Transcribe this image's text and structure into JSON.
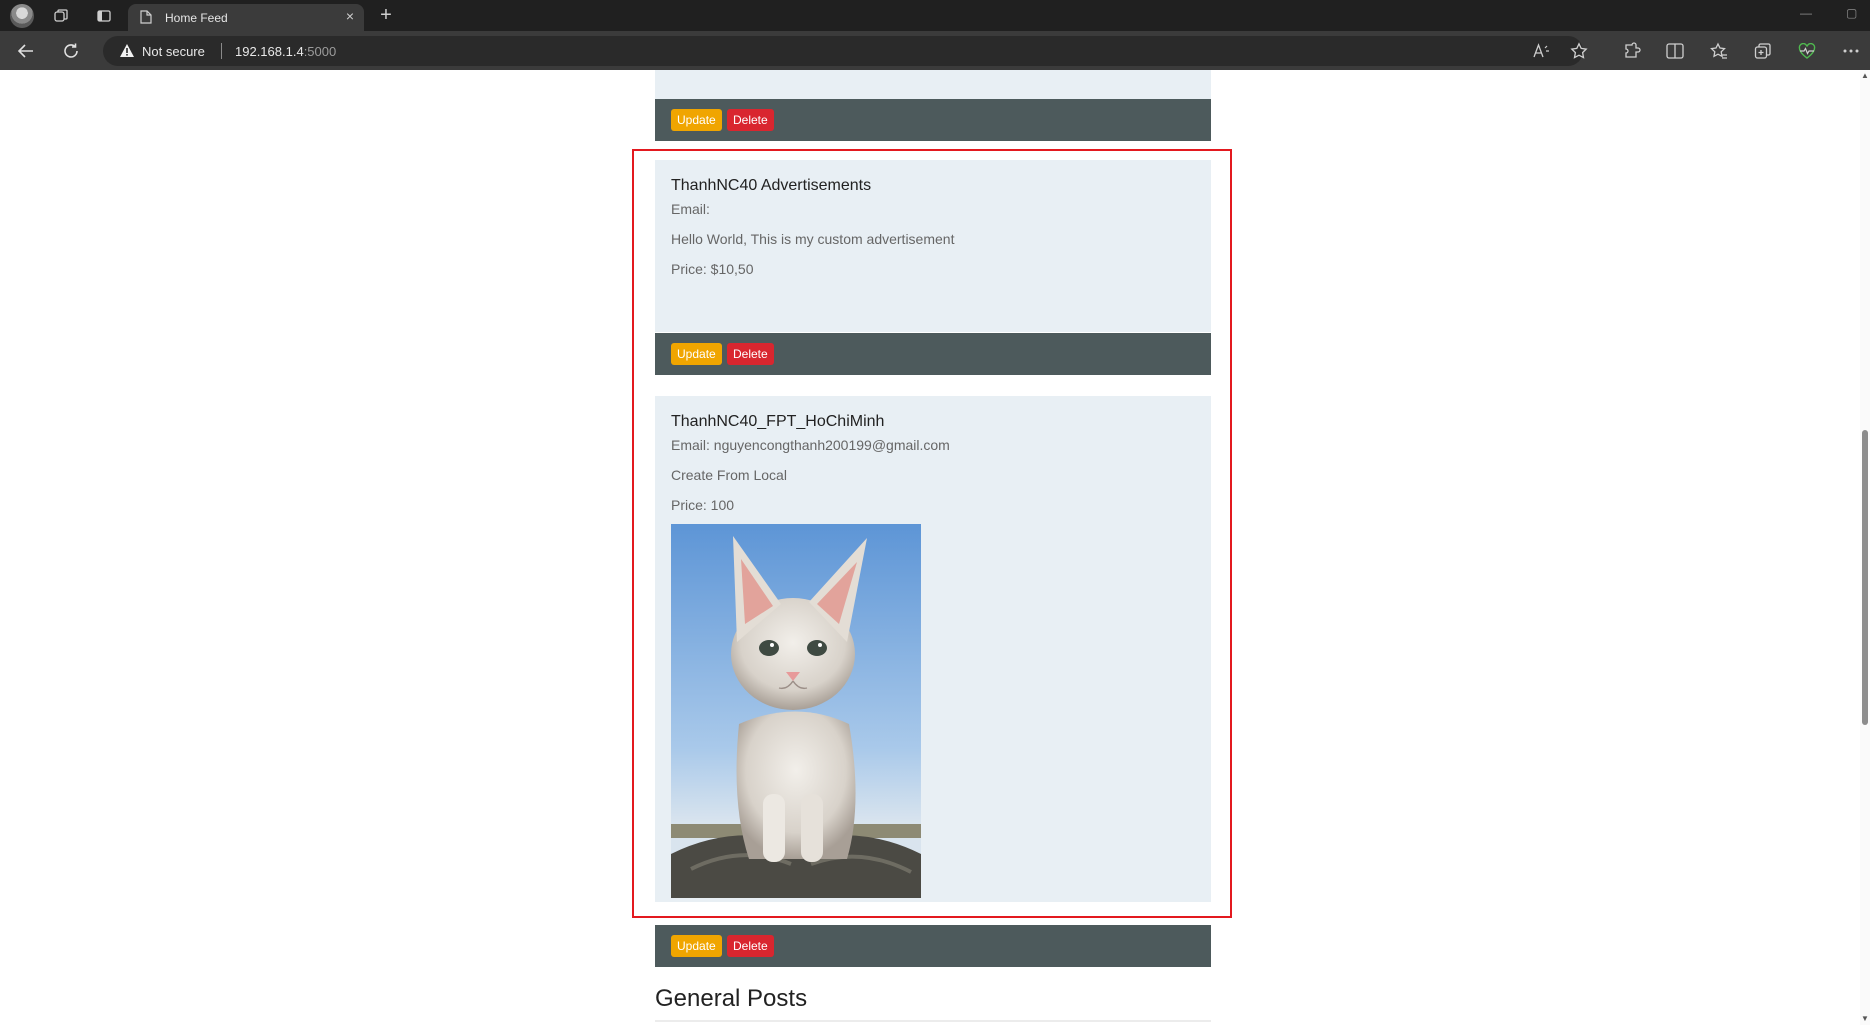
{
  "browser": {
    "tab_title": "Home Feed",
    "tab_close": "×",
    "new_tab": "+",
    "security_label": "Not secure",
    "url_host": "192.168.1.4",
    "url_port": ":5000",
    "window_min": "—",
    "window_restore": "▢"
  },
  "feed": {
    "top_card_actions": {
      "update_label": "Update",
      "delete_label": "Delete"
    },
    "ads": [
      {
        "title": "ThanhNC40 Advertisements",
        "email": "Email:",
        "description": "Hello World, This is my custom advertisement",
        "price": "Price: $10,50",
        "update_label": "Update",
        "delete_label": "Delete"
      },
      {
        "title": "ThanhNC40_FPT_HoChiMinh",
        "email": "Email: nguyencongthanh200199@gmail.com",
        "description": "Create From Local",
        "price": "Price: 100",
        "image": "kitten-photo",
        "update_label": "Update",
        "delete_label": "Delete"
      }
    ]
  },
  "general_section": {
    "heading": "General Posts"
  },
  "colors": {
    "card_bg": "#e8eff4",
    "footer_bg": "#4d5a5c",
    "update": "#f0a500",
    "delete": "#d9262f",
    "highlight": "#e3191f"
  }
}
